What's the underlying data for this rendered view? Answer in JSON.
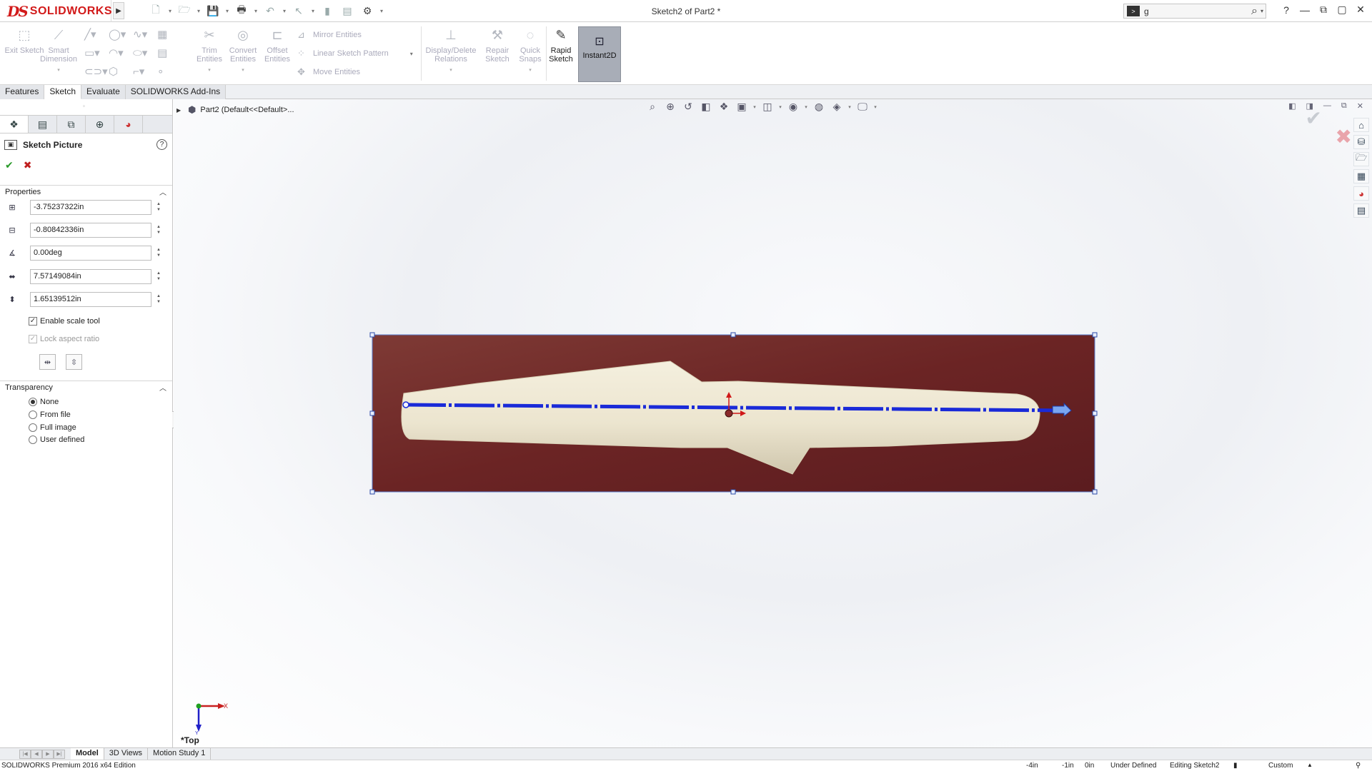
{
  "app": {
    "brand_mark": "DS",
    "brand_name": "SOLIDWORKS",
    "doc_title": "Sketch2 of Part2 *"
  },
  "search": {
    "value": "g",
    "placeholder": ""
  },
  "command_manager": {
    "exit_sketch": "Exit Sketch",
    "smart_dimension": "Smart Dimension",
    "trim_entities": "Trim Entities",
    "convert_entities": "Convert Entities",
    "offset_entities": "Offset Entities",
    "mirror_entities": "Mirror Entities",
    "linear_sketch_pattern": "Linear Sketch Pattern",
    "move_entities": "Move Entities",
    "display_delete_relations": "Display/Delete Relations",
    "repair_sketch": "Repair Sketch",
    "quick_snaps": "Quick Snaps",
    "rapid_sketch": "Rapid Sketch",
    "instant2d": "Instant2D"
  },
  "tabs": [
    "Features",
    "Sketch",
    "Evaluate",
    "SOLIDWORKS Add-Ins"
  ],
  "property_manager": {
    "title": "Sketch Picture",
    "help": "?",
    "properties_label": "Properties",
    "x_position": "-3.75237322in",
    "y_position": "-0.80842336in",
    "angle": "0.00deg",
    "width": "7.57149084in",
    "height": "1.65139512in",
    "enable_scale_tool": "Enable scale tool",
    "lock_aspect_ratio": "Lock aspect ratio",
    "transparency_label": "Transparency",
    "transparency_options": [
      "None",
      "From file",
      "Full image",
      "User defined"
    ],
    "transparency_selected": "None"
  },
  "feature_tree": {
    "root": "Part2  (Default<<Default>..."
  },
  "view": {
    "orientation": "*Top",
    "axis_x": "X",
    "axis_y": "Y"
  },
  "bottom_tabs": [
    "Model",
    "3D Views",
    "Motion Study 1"
  ],
  "status": {
    "edition": "SOLIDWORKS Premium 2016 x64 Edition",
    "coord_x": "-4in",
    "coord_y": "-1in",
    "coord_z": "0in",
    "state": "Under Defined",
    "editing": "Editing Sketch2",
    "units": "Custom"
  },
  "colors": {
    "brand_red": "#d21a1a",
    "sketch_blue": "#1a2ad8",
    "photo_bg": "#6b2424",
    "part_cream": "#efe9d6"
  }
}
